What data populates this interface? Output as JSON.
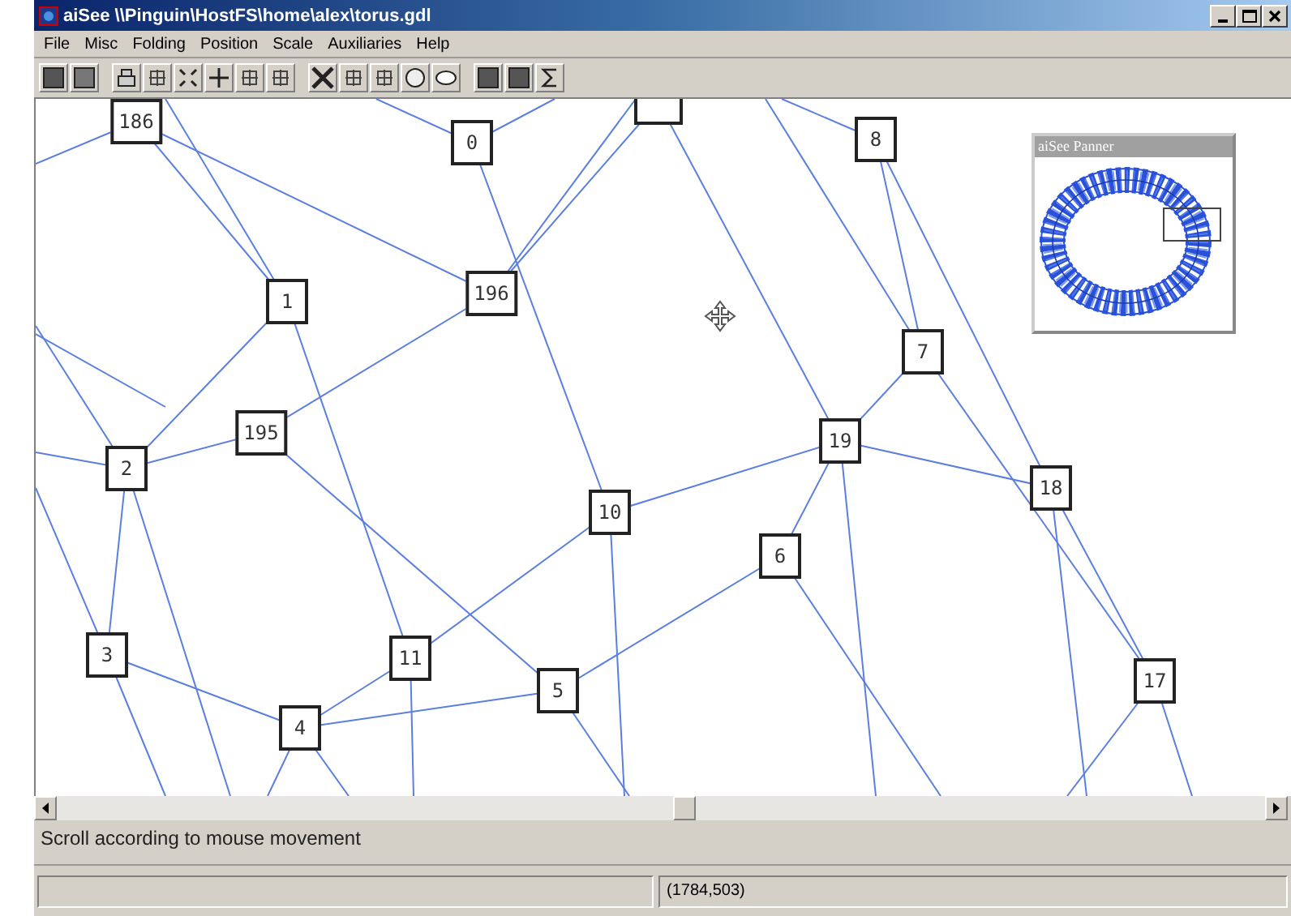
{
  "window": {
    "title": "aiSee \\\\Pinguin\\HostFS\\home\\alex\\torus.gdl"
  },
  "menu": [
    "File",
    "Misc",
    "Folding",
    "Position",
    "Scale",
    "Auxiliaries",
    "Help"
  ],
  "nodes": [
    {
      "kind": "box",
      "label": "186"
    },
    {
      "kind": "box",
      "label": "0"
    },
    {
      "kind": "cut"
    },
    {
      "kind": "box",
      "label": "8"
    },
    {
      "kind": "box",
      "label": "1"
    },
    {
      "kind": "box",
      "label": "196"
    },
    {
      "kind": "box",
      "label": "7"
    },
    {
      "kind": "box",
      "label": "195"
    },
    {
      "kind": "box",
      "label": "19"
    },
    {
      "kind": "box",
      "label": "2"
    },
    {
      "kind": "box",
      "label": "18"
    },
    {
      "kind": "box",
      "label": "10"
    },
    {
      "kind": "box",
      "label": "6"
    },
    {
      "kind": "box",
      "label": "3"
    },
    {
      "kind": "box",
      "label": "11"
    },
    {
      "kind": "box",
      "label": "5"
    },
    {
      "kind": "box",
      "label": "4"
    },
    {
      "kind": "box",
      "label": "17"
    }
  ],
  "panner": {
    "title": "aiSee Panner"
  },
  "message": "Scroll according to mouse movement",
  "status_bar": {
    "coordinates": "(1784,503)"
  }
}
